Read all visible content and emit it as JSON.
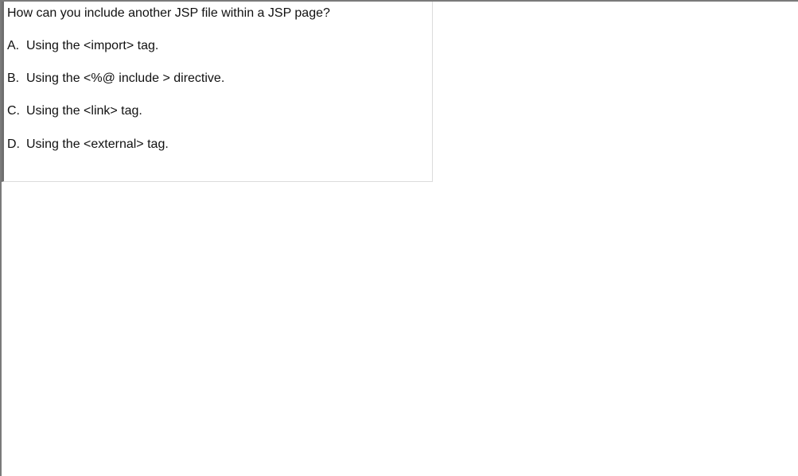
{
  "quiz": {
    "question": "How can you include another JSP file within a JSP page?",
    "options": [
      {
        "letter": "A.",
        "text": "Using the <import> tag."
      },
      {
        "letter": "B.",
        "text": "Using the <%@ include > directive."
      },
      {
        "letter": "C.",
        "text": "Using the <link> tag."
      },
      {
        "letter": "D.",
        "text": "Using the <external> tag."
      }
    ]
  }
}
